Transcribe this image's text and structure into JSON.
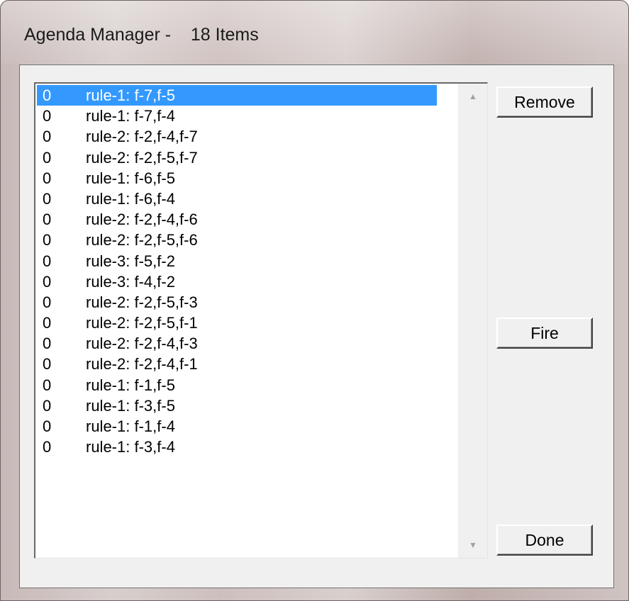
{
  "window": {
    "title": "Agenda Manager -    18 Items"
  },
  "agenda": {
    "items": [
      {
        "priority": "0",
        "activation": "rule-1: f-7,f-5",
        "selected": true
      },
      {
        "priority": "0",
        "activation": "rule-1: f-7,f-4"
      },
      {
        "priority": "0",
        "activation": "rule-2: f-2,f-4,f-7"
      },
      {
        "priority": "0",
        "activation": "rule-2: f-2,f-5,f-7"
      },
      {
        "priority": "0",
        "activation": "rule-1: f-6,f-5"
      },
      {
        "priority": "0",
        "activation": "rule-1: f-6,f-4"
      },
      {
        "priority": "0",
        "activation": "rule-2: f-2,f-4,f-6"
      },
      {
        "priority": "0",
        "activation": "rule-2: f-2,f-5,f-6"
      },
      {
        "priority": "0",
        "activation": "rule-3: f-5,f-2"
      },
      {
        "priority": "0",
        "activation": "rule-3: f-4,f-2"
      },
      {
        "priority": "0",
        "activation": "rule-2: f-2,f-5,f-3"
      },
      {
        "priority": "0",
        "activation": "rule-2: f-2,f-5,f-1"
      },
      {
        "priority": "0",
        "activation": "rule-2: f-2,f-4,f-3"
      },
      {
        "priority": "0",
        "activation": "rule-2: f-2,f-4,f-1"
      },
      {
        "priority": "0",
        "activation": "rule-1: f-1,f-5"
      },
      {
        "priority": "0",
        "activation": "rule-1: f-3,f-5"
      },
      {
        "priority": "0",
        "activation": "rule-1: f-1,f-4"
      },
      {
        "priority": "0",
        "activation": "rule-1: f-3,f-4"
      }
    ]
  },
  "buttons": {
    "remove": "Remove",
    "fire": "Fire",
    "done": "Done"
  },
  "icons": {
    "scroll_up": "scroll-up-arrow-icon",
    "scroll_down": "scroll-down-arrow-icon"
  },
  "colors": {
    "selection": "#3399ff",
    "dialog_face": "#f0f0f0"
  }
}
